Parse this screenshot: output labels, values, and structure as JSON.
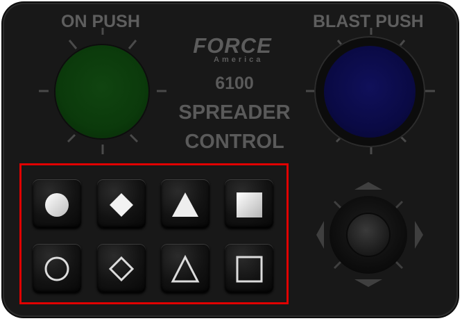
{
  "panel": {
    "left_button_label": "ON PUSH",
    "right_button_label": "BLAST PUSH",
    "brand": "FORCE",
    "brand_sub": "America",
    "model": "6100",
    "title_line1": "SPREADER",
    "title_line2": "CONTROL"
  },
  "colors": {
    "on_push_knob": "#0b3a0b",
    "blast_push_knob": "#0a0a45",
    "highlight": "#e00000"
  },
  "buttons": [
    {
      "icon": "filled-circle-icon"
    },
    {
      "icon": "filled-diamond-icon"
    },
    {
      "icon": "filled-triangle-icon"
    },
    {
      "icon": "filled-square-icon"
    },
    {
      "icon": "outline-circle-icon"
    },
    {
      "icon": "outline-diamond-icon"
    },
    {
      "icon": "outline-triangle-icon"
    },
    {
      "icon": "outline-square-icon"
    }
  ],
  "joystick": {
    "directions": [
      "up-arrow-icon",
      "down-arrow-icon",
      "left-arrow-icon",
      "right-arrow-icon"
    ]
  }
}
